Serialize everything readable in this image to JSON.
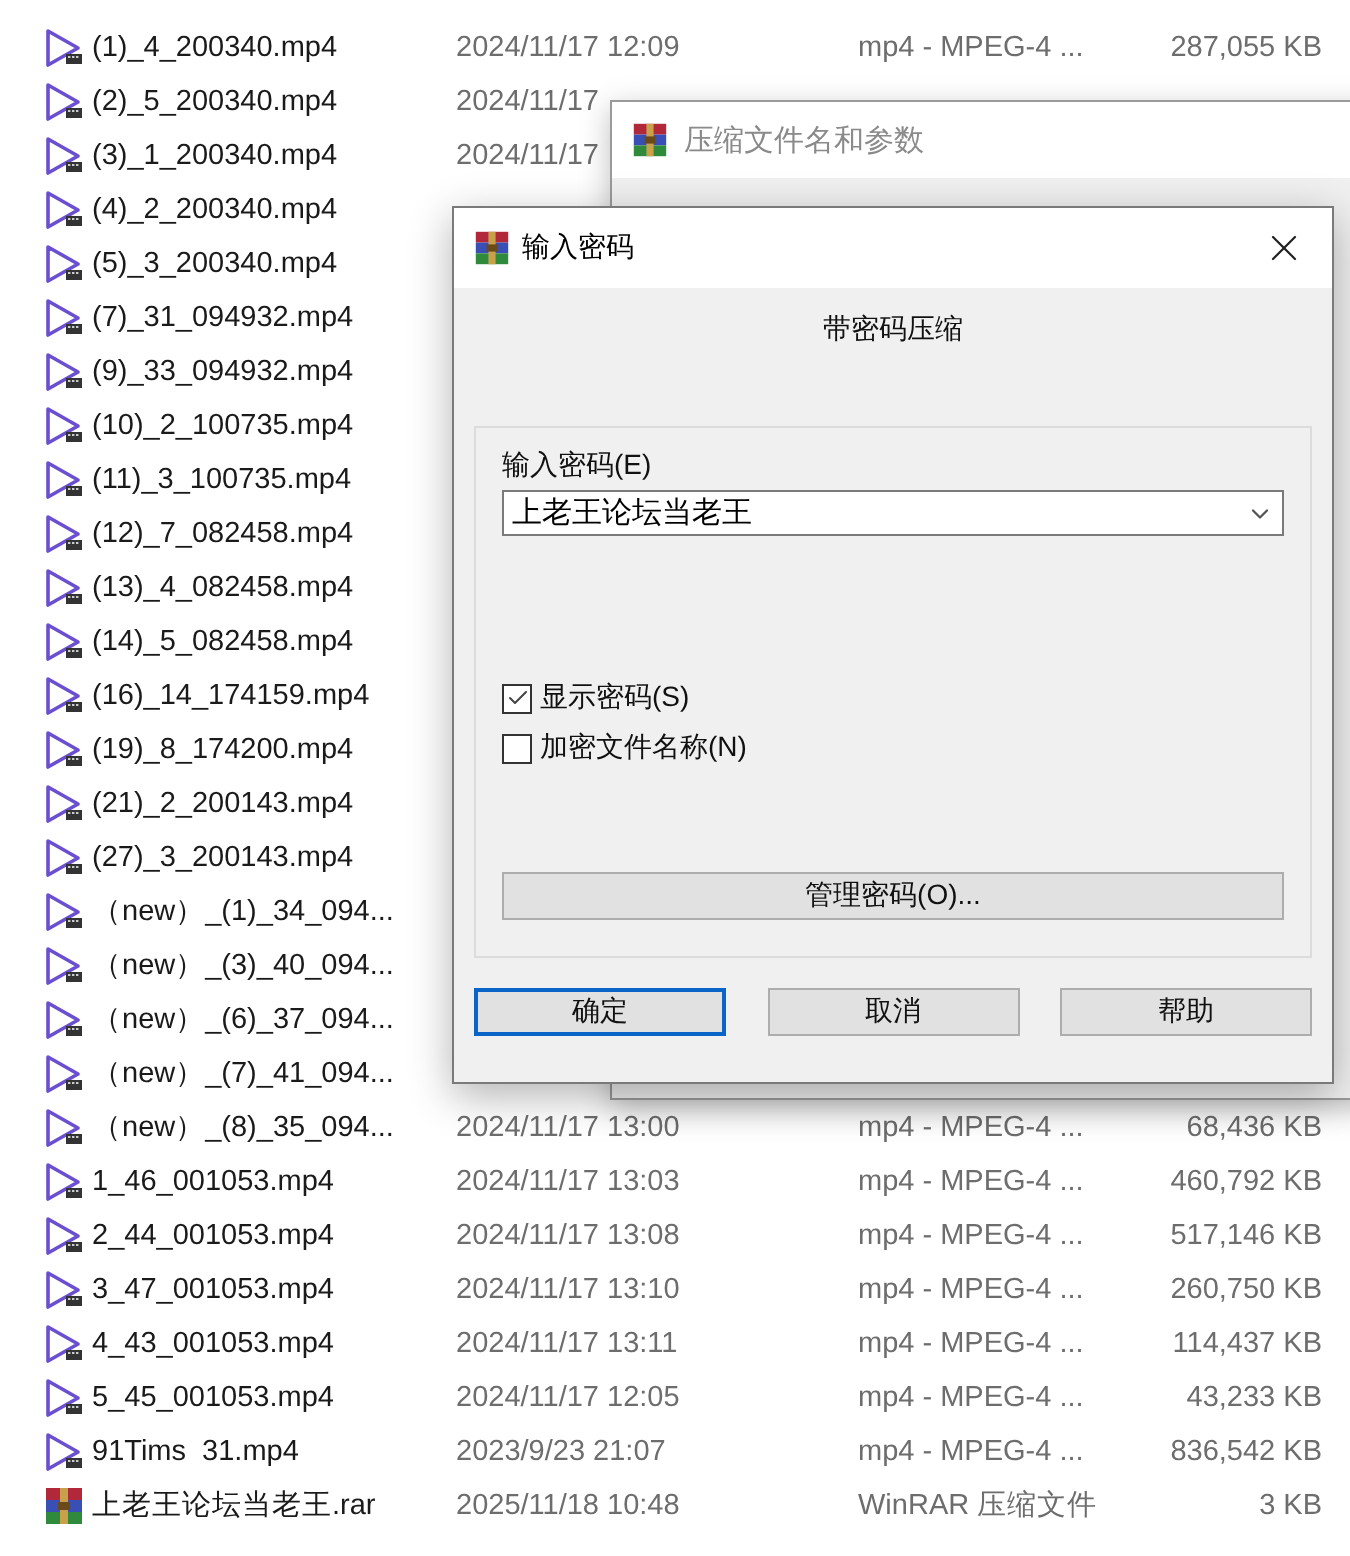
{
  "files": [
    {
      "kind": "video",
      "name": "(1)_4_200340.mp4",
      "date": "2024/11/17 12:09",
      "type": "mp4 - MPEG-4 ...",
      "size": "287,055 KB"
    },
    {
      "kind": "video",
      "name": "(2)_5_200340.mp4",
      "date": "2024/11/17"
    },
    {
      "kind": "video",
      "name": "(3)_1_200340.mp4",
      "date": "2024/11/17"
    },
    {
      "kind": "video",
      "name": "(4)_2_200340.mp4"
    },
    {
      "kind": "video",
      "name": "(5)_3_200340.mp4"
    },
    {
      "kind": "video",
      "name": "(7)_31_094932.mp4"
    },
    {
      "kind": "video",
      "name": "(9)_33_094932.mp4"
    },
    {
      "kind": "video",
      "name": "(10)_2_100735.mp4"
    },
    {
      "kind": "video",
      "name": "(11)_3_100735.mp4"
    },
    {
      "kind": "video",
      "name": "(12)_7_082458.mp4"
    },
    {
      "kind": "video",
      "name": "(13)_4_082458.mp4"
    },
    {
      "kind": "video",
      "name": "(14)_5_082458.mp4"
    },
    {
      "kind": "video",
      "name": "(16)_14_174159.mp4"
    },
    {
      "kind": "video",
      "name": "(19)_8_174200.mp4"
    },
    {
      "kind": "video",
      "name": "(21)_2_200143.mp4"
    },
    {
      "kind": "video",
      "name": "(27)_3_200143.mp4"
    },
    {
      "kind": "video",
      "name": "（new）_(1)_34_094..."
    },
    {
      "kind": "video",
      "name": "（new）_(3)_40_094..."
    },
    {
      "kind": "video",
      "name": "（new）_(6)_37_094..."
    },
    {
      "kind": "video",
      "name": "（new）_(7)_41_094..."
    },
    {
      "kind": "video",
      "name": "（new）_(8)_35_094...",
      "date": "2024/11/17 13:00",
      "type": "mp4 - MPEG-4 ...",
      "size": "68,436 KB"
    },
    {
      "kind": "video",
      "name": "1_46_001053.mp4",
      "date": "2024/11/17 13:03",
      "type": "mp4 - MPEG-4 ...",
      "size": "460,792 KB"
    },
    {
      "kind": "video",
      "name": "2_44_001053.mp4",
      "date": "2024/11/17 13:08",
      "type": "mp4 - MPEG-4 ...",
      "size": "517,146 KB"
    },
    {
      "kind": "video",
      "name": "3_47_001053.mp4",
      "date": "2024/11/17 13:10",
      "type": "mp4 - MPEG-4 ...",
      "size": "260,750 KB"
    },
    {
      "kind": "video",
      "name": "4_43_001053.mp4",
      "date": "2024/11/17 13:11",
      "type": "mp4 - MPEG-4 ...",
      "size": "114,437 KB"
    },
    {
      "kind": "video",
      "name": "5_45_001053.mp4",
      "date": "2024/11/17 12:05",
      "type": "mp4 - MPEG-4 ...",
      "size": "43,233 KB"
    },
    {
      "kind": "video",
      "name": "91Tims  31.mp4",
      "date": "2023/9/23 21:07",
      "type": "mp4 - MPEG-4 ...",
      "size": "836,542 KB"
    },
    {
      "kind": "archive",
      "name": "上老王论坛当老王.rar",
      "date": "2025/11/18 10:48",
      "type": "WinRAR 压缩文件",
      "size": "3 KB"
    }
  ],
  "back_dialog": {
    "title": "压缩文件名和参数"
  },
  "dialog": {
    "title": "输入密码",
    "heading": "带密码压缩",
    "password_label": "输入密码(E)",
    "password_value": "上老王论坛当老王",
    "options": [
      {
        "label": "显示密码(S)",
        "checked": true
      },
      {
        "label": "加密文件名称(N)",
        "checked": false
      }
    ],
    "manage_button": "管理密码(O)...",
    "buttons": [
      {
        "label": "确定",
        "selected": true
      },
      {
        "label": "取消",
        "selected": false
      },
      {
        "label": "帮助",
        "selected": false
      }
    ]
  }
}
